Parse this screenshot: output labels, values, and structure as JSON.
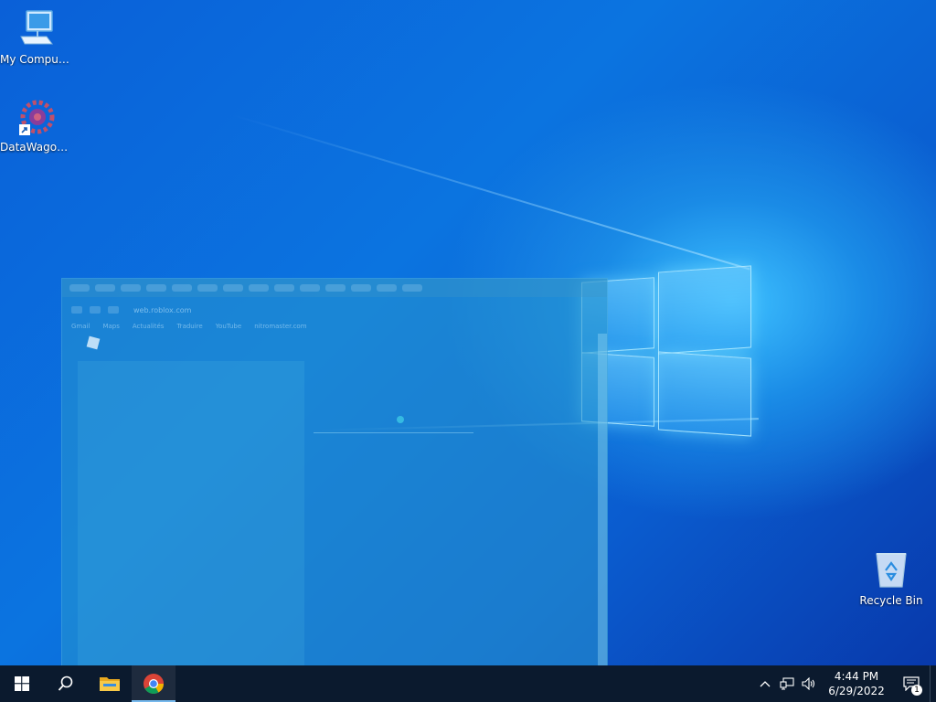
{
  "desktop": {
    "icons": [
      {
        "label": "My Computer",
        "icon": "computer-icon"
      },
      {
        "label": "DataWagon...",
        "icon": "gear-app-icon"
      },
      {
        "label": "Recycle Bin",
        "icon": "recycle-bin-icon"
      }
    ]
  },
  "ghost_window": {
    "url": "web.roblox.com",
    "bookmarks": [
      "Gmail",
      "Maps",
      "Actualités",
      "Traduire",
      "YouTube",
      "nitromaster.com"
    ]
  },
  "taskbar": {
    "start": "start-icon",
    "search": "search-icon",
    "apps": [
      {
        "name": "File Explorer",
        "icon": "folder-icon"
      },
      {
        "name": "Google Chrome",
        "icon": "chrome-icon"
      }
    ]
  },
  "tray": {
    "time": "4:44 PM",
    "date": "6/29/2022",
    "notification_count": "1"
  },
  "colors": {
    "taskbar": "#0b1a2e",
    "accent": "#76b9ed",
    "wallpaper": "#0b74e0"
  }
}
